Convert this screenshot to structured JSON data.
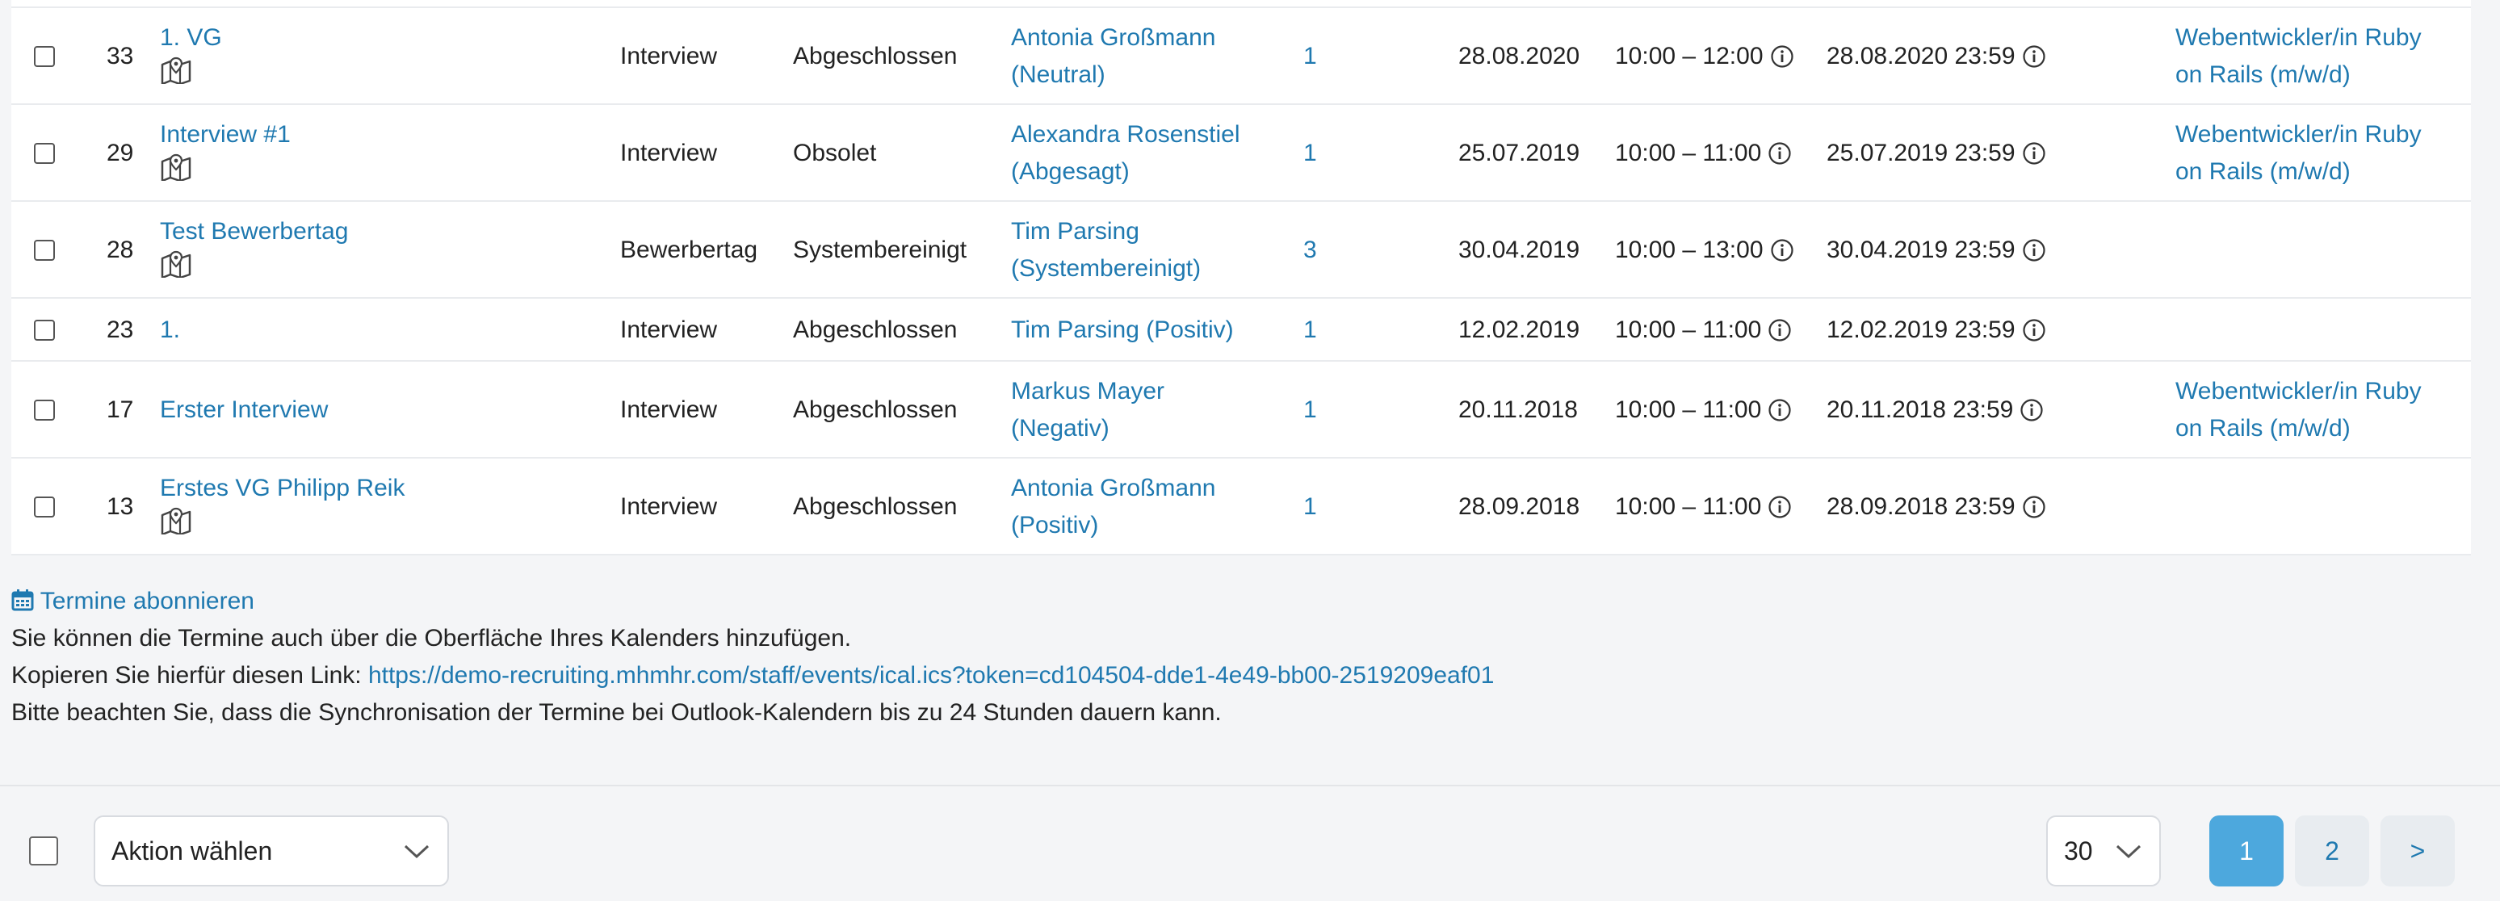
{
  "table": {
    "rows": [
      {
        "id": "33",
        "title": "1. VG",
        "has_map": true,
        "type": "Interview",
        "status": "Abgeschlossen",
        "candidate_line1": "Antonia Großmann",
        "candidate_line2": "(Neutral)",
        "count": "1",
        "date": "28.08.2020",
        "time": "10:00 – 12:00",
        "deadline": "28.08.2020 23:59",
        "job_line1": "Webentwickler/in Ruby",
        "job_line2": "on Rails (m/w/d)"
      },
      {
        "id": "29",
        "title": "Interview #1",
        "has_map": true,
        "type": "Interview",
        "status": "Obsolet",
        "candidate_line1": "Alexandra Rosenstiel",
        "candidate_line2": "(Abgesagt)",
        "count": "1",
        "date": "25.07.2019",
        "time": "10:00 – 11:00",
        "deadline": "25.07.2019 23:59",
        "job_line1": "Webentwickler/in Ruby",
        "job_line2": "on Rails (m/w/d)"
      },
      {
        "id": "28",
        "title": "Test Bewerbertag",
        "has_map": true,
        "type": "Bewerbertag",
        "status": "Systembereinigt",
        "candidate_line1": "Tim Parsing",
        "candidate_line2": "(Systembereinigt)",
        "count": "3",
        "date": "30.04.2019",
        "time": "10:00 – 13:00",
        "deadline": "30.04.2019 23:59",
        "job_line1": "",
        "job_line2": ""
      },
      {
        "id": "23",
        "title": "1.",
        "has_map": false,
        "type": "Interview",
        "status": "Abgeschlossen",
        "candidate_line1": "Tim Parsing (Positiv)",
        "candidate_line2": "",
        "count": "1",
        "date": "12.02.2019",
        "time": "10:00 – 11:00",
        "deadline": "12.02.2019 23:59",
        "job_line1": "",
        "job_line2": ""
      },
      {
        "id": "17",
        "title": "Erster Interview",
        "has_map": false,
        "type": "Interview",
        "status": "Abgeschlossen",
        "candidate_line1": "Markus Mayer",
        "candidate_line2": "(Negativ)",
        "count": "1",
        "date": "20.11.2018",
        "time": "10:00 – 11:00",
        "deadline": "20.11.2018 23:59",
        "job_line1": "Webentwickler/in Ruby",
        "job_line2": "on Rails (m/w/d)"
      },
      {
        "id": "13",
        "title": "Erstes VG Philipp Reik",
        "has_map": true,
        "type": "Interview",
        "status": "Abgeschlossen",
        "candidate_line1": "Antonia Großmann",
        "candidate_line2": "(Positiv)",
        "count": "1",
        "date": "28.09.2018",
        "time": "10:00 – 11:00",
        "deadline": "28.09.2018 23:59",
        "job_line1": "",
        "job_line2": ""
      }
    ]
  },
  "subscribe": {
    "link_label": "Termine abonnieren",
    "line1": "Sie können die Termine auch über die Oberfläche Ihres Kalenders hinzufügen.",
    "line2_prefix": "Kopieren Sie hierfür diesen Link: ",
    "ical_url": "https://demo-recruiting.mhmhr.com/staff/events/ical.ics?token=cd104504-dde1-4e49-bb00-2519209eaf01",
    "line3": "Bitte beachten Sie, dass die Synchronisation der Termine bei Outlook-Kalendern bis zu 24 Stunden dauern kann."
  },
  "bottom_bar": {
    "action_select_value": "Aktion wählen",
    "per_page_value": "30",
    "pages": [
      "1",
      "2"
    ],
    "next_label": ">",
    "active_page": "1"
  },
  "colors": {
    "link": "#1f79b0",
    "pager_active": "#4da8dd",
    "pager_inactive": "#e8ecf0"
  }
}
